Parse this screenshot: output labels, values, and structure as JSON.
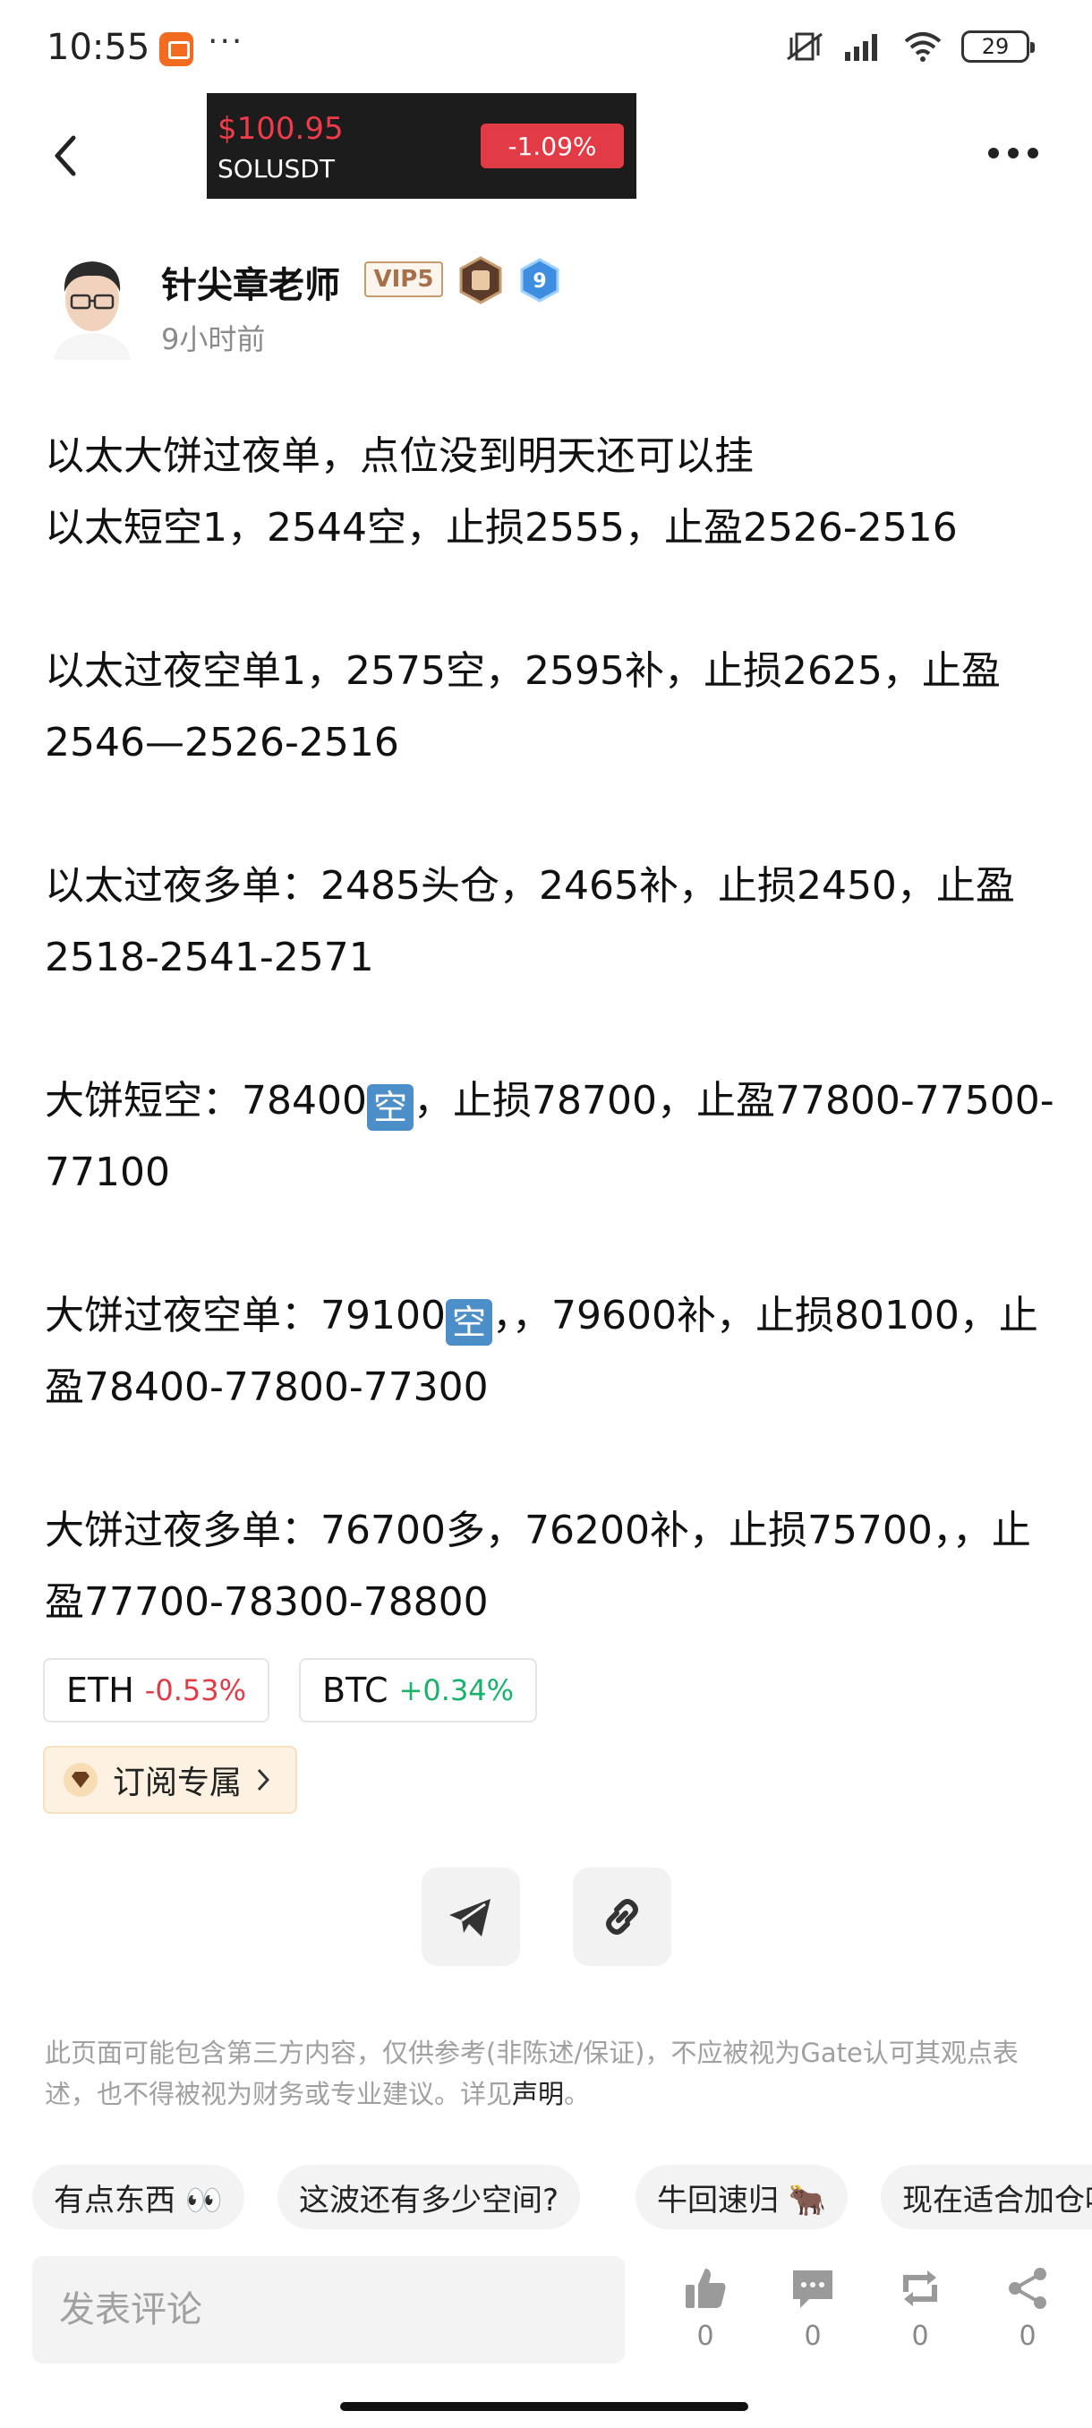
{
  "status_bar": {
    "time": "10:55",
    "more": "···",
    "battery": "29"
  },
  "ticker": {
    "price": "$100.95",
    "symbol": "SOLUSDT",
    "change": "-1.09%"
  },
  "author": {
    "name": "针尖章老师",
    "vip": "VIP5",
    "level": "9",
    "time": "9小时前"
  },
  "content": {
    "lines": [
      "以太大饼过夜单，点位没到明天还可以挂",
      "以太短空1，2544空，止损2555，止盈2526-2516",
      "",
      "以太过夜空单1，2575空，2595补，止损2625，止盈2546—2526-2516",
      "",
      "以太过夜多单：2485头仓，2465补，止损2450，止盈2518-2541-2571",
      "",
      "大饼短空：78400",
      "",
      "大饼过夜空单：79100",
      "",
      "大饼过夜多单：76700多，76200补，止损75700，，止盈77700-78300-78800"
    ],
    "short_prefix": "大饼短空：78400",
    "short_suffix": "，止损78700，止盈77800-77500-77100",
    "overnight_short_prefix": "大饼过夜空单：79100",
    "overnight_short_suffix": "，，79600补，止损80100，止盈78400-77800-77300",
    "emoji": "空"
  },
  "tags": [
    {
      "coin": "ETH",
      "change": "-0.53%"
    },
    {
      "coin": "BTC",
      "change": "+0.34%"
    }
  ],
  "subscribe": {
    "label": "订阅专属"
  },
  "disclaimer": {
    "text": "此页面可能包含第三方内容，仅供参考(非陈述/保证)，不应被视为Gate认可其观点表述，也不得被视为财务或专业建议。详见",
    "link": "声明",
    "end": "。"
  },
  "suggestions": [
    "有点东西 👀",
    "这波还有多少空间?",
    "牛回速归 🐂",
    "现在适合加仓吗"
  ],
  "bottom": {
    "comment_placeholder": "发表评论",
    "counts": {
      "like": "0",
      "comment": "0",
      "repost": "0",
      "share": "0"
    }
  },
  "colors": {
    "down": "#e23b46",
    "up": "#19b26b",
    "ticker_bg": "#1c1c1c"
  }
}
